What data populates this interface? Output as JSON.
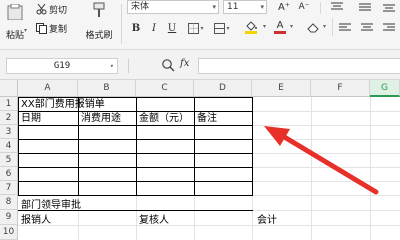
{
  "ribbon": {
    "paste_label": "粘贴",
    "cut_label": "剪切",
    "copy_label": "复制",
    "format_painter_label": "格式刷",
    "font_name": "宋体",
    "font_size": "11",
    "font_color": "#d03030",
    "fill_color": "#f5d300",
    "grow_font_label": "A⁺",
    "shrink_font_label": "A⁻",
    "font_color_label": "A",
    "fill_label": "◈"
  },
  "formula_bar": {
    "cell_ref": "G19",
    "fx_label": "fx",
    "formula": ""
  },
  "sheet": {
    "columns": [
      "A",
      "B",
      "C",
      "D",
      "E",
      "F",
      "G"
    ],
    "active_column": "G",
    "rows": [
      "1",
      "2",
      "3",
      "4",
      "5",
      "6",
      "7",
      "8",
      "9",
      "10"
    ],
    "cells": {
      "A1": "XX部门费用报销单",
      "A2": "日期",
      "B2": "消费用途",
      "C2": "金额（元）",
      "D2": "备注",
      "A8": "部门领导审批",
      "A9": "报销人",
      "C9": "复核人",
      "E9": "会计"
    },
    "arrow_color": "#e8302a",
    "header_accent": "#2d9950"
  }
}
